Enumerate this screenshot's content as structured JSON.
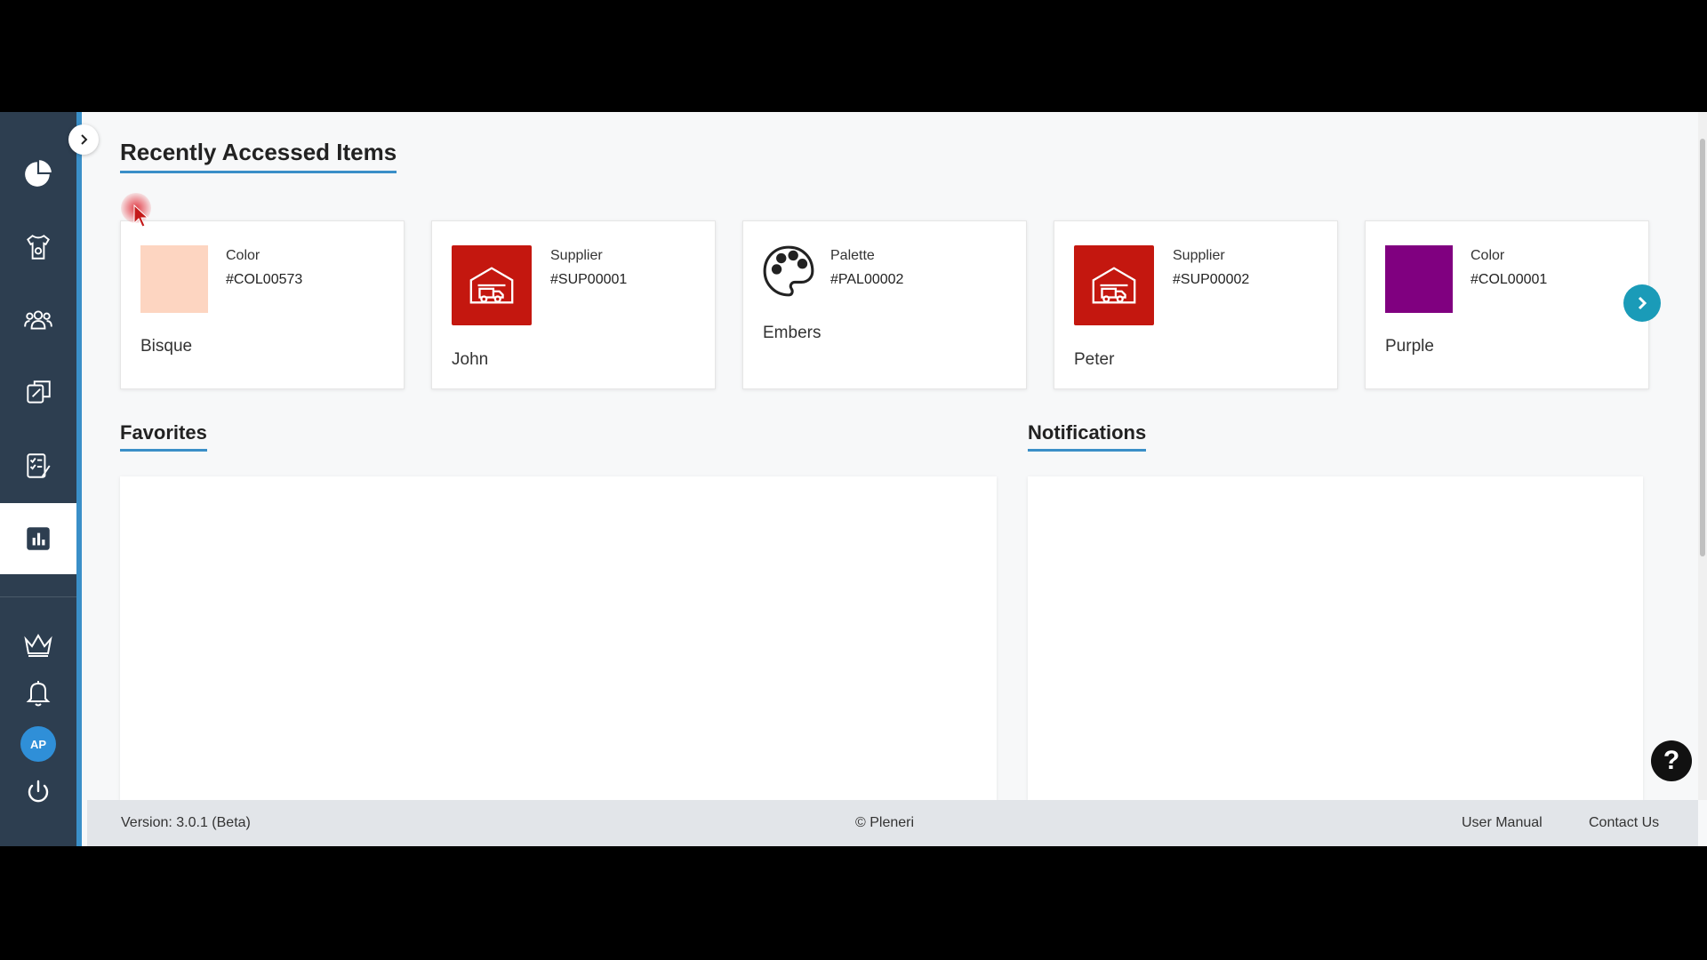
{
  "sidebar": {
    "nav": [
      {
        "icon": "pie-chart-icon"
      },
      {
        "icon": "garment-icon"
      },
      {
        "icon": "users-icon"
      },
      {
        "icon": "design-tools-icon"
      },
      {
        "icon": "checklist-icon"
      },
      {
        "icon": "bar-chart-icon",
        "active": true
      }
    ],
    "bottom": [
      {
        "icon": "crown-icon"
      },
      {
        "icon": "bell-icon"
      },
      {
        "icon": "avatar",
        "label": "AP"
      },
      {
        "icon": "power-icon"
      }
    ]
  },
  "recent": {
    "title": "Recently Accessed Items",
    "items": [
      {
        "type": "Color",
        "code": "#COL00573",
        "name": "Bisque",
        "swatch": "#fdd5c1"
      },
      {
        "type": "Supplier",
        "code": "#SUP00001",
        "name": "John"
      },
      {
        "type": "Palette",
        "code": "#PAL00002",
        "name": "Embers"
      },
      {
        "type": "Supplier",
        "code": "#SUP00002",
        "name": "Peter"
      },
      {
        "type": "Color",
        "code": "#COL00001",
        "name": "Purple",
        "swatch": "#800080"
      }
    ]
  },
  "favorites": {
    "title": "Favorites"
  },
  "notifications": {
    "title": "Notifications"
  },
  "footer": {
    "version": "Version: 3.0.1 (Beta)",
    "copyright": "© Pleneri",
    "manual": "User Manual",
    "contact": "Contact Us"
  },
  "help": {
    "label": "?"
  },
  "colors": {
    "sidebar_bg": "#2d3e50",
    "accent": "#3a8fc8",
    "supplier_red": "#c4170f",
    "next_button": "#1a9bb8"
  }
}
